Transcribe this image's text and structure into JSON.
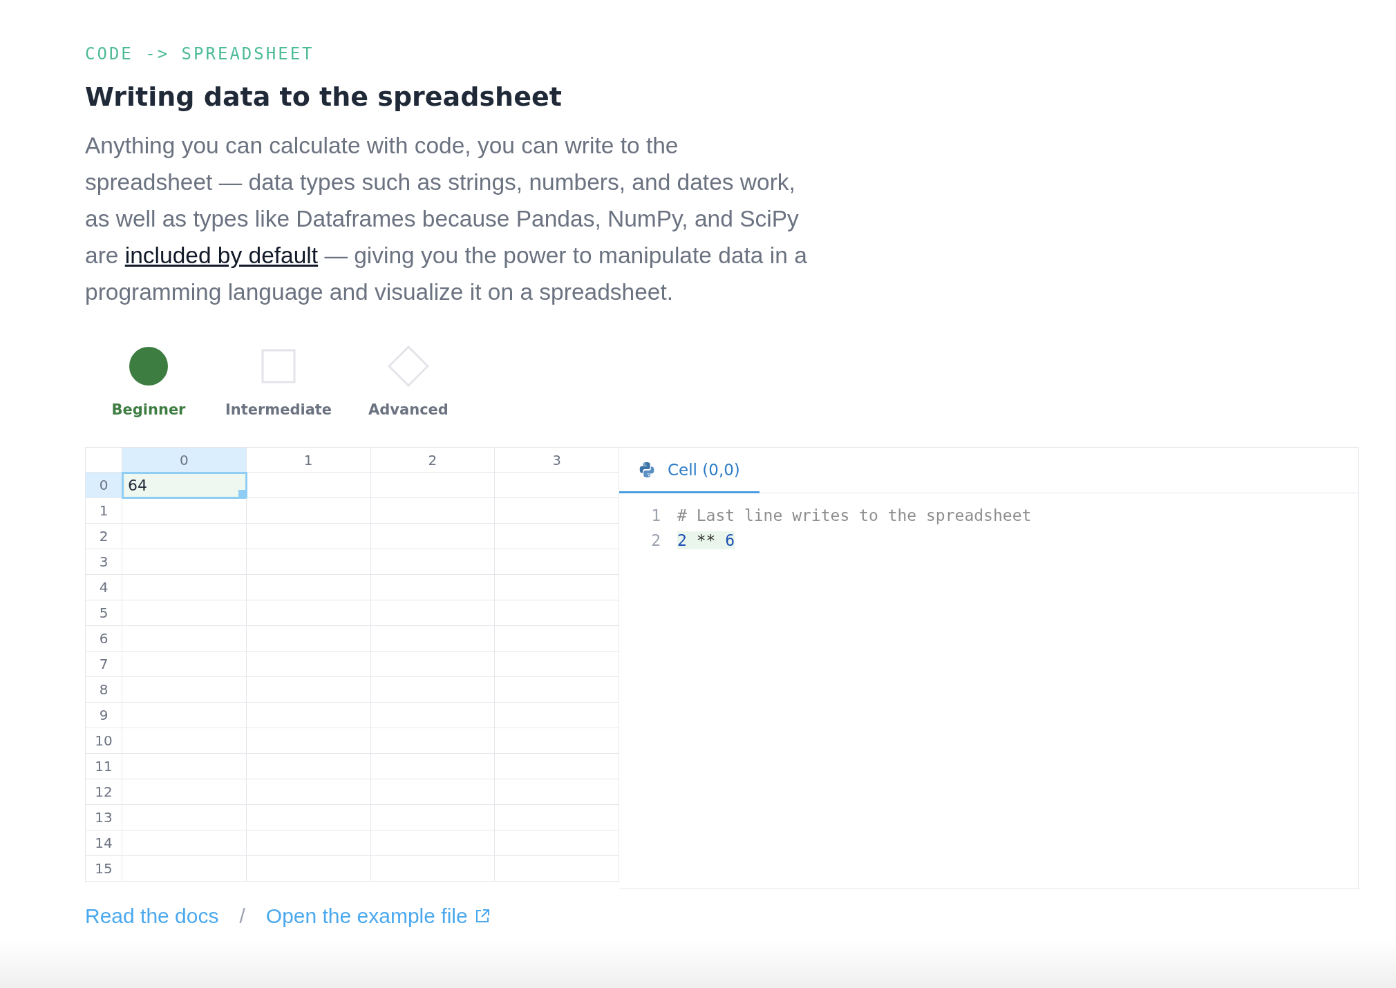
{
  "eyebrow": "CODE -> SPREADSHEET",
  "title": "Writing data to the spreadsheet",
  "description": {
    "before": "Anything you can calculate with code, you can write to the spreadsheet — data types such as strings, numbers, and dates work, as well as types like Dataframes because Pandas, NumPy, and SciPy are ",
    "link": "included by default",
    "after": " — giving you the power to manipulate data in a programming language and visualize it on a spreadsheet."
  },
  "levels": [
    {
      "label": "Beginner",
      "kind": "circle",
      "selected": true
    },
    {
      "label": "Intermediate",
      "kind": "square",
      "selected": false
    },
    {
      "label": "Advanced",
      "kind": "diamond",
      "selected": false
    }
  ],
  "grid": {
    "columns": [
      {
        "label": "0",
        "selected": true
      },
      {
        "label": "1",
        "selected": false
      },
      {
        "label": "2",
        "selected": false
      },
      {
        "label": "3",
        "selected": false
      }
    ],
    "rows": [
      {
        "label": "0",
        "selected": true,
        "cells": [
          "64"
        ]
      },
      {
        "label": "1",
        "selected": false
      },
      {
        "label": "2",
        "selected": false
      },
      {
        "label": "3",
        "selected": false
      },
      {
        "label": "4",
        "selected": false
      },
      {
        "label": "5",
        "selected": false
      },
      {
        "label": "6",
        "selected": false
      },
      {
        "label": "7",
        "selected": false
      },
      {
        "label": "8",
        "selected": false
      },
      {
        "label": "9",
        "selected": false
      },
      {
        "label": "10",
        "selected": false
      },
      {
        "label": "11",
        "selected": false
      },
      {
        "label": "12",
        "selected": false
      },
      {
        "label": "13",
        "selected": false
      },
      {
        "label": "14",
        "selected": false
      },
      {
        "label": "15",
        "selected": false
      }
    ]
  },
  "editor": {
    "tabs": [
      {
        "label": "Cell (0,0)",
        "selected": true
      }
    ],
    "lines": [
      {
        "number": "1",
        "highlighted": false,
        "tokens": [
          {
            "kind": "comment",
            "text": "# Last line writes to the spreadsheet"
          }
        ]
      },
      {
        "number": "2",
        "highlighted": true,
        "tokens": [
          {
            "kind": "number",
            "text": "2"
          },
          {
            "kind": "operator",
            "text": " ** "
          },
          {
            "kind": "number",
            "text": "6"
          }
        ]
      }
    ]
  },
  "links": [
    {
      "label": "Read the docs",
      "kind": "plain"
    },
    {
      "label": "Open the example file",
      "kind": "external"
    }
  ],
  "link_separator": "/"
}
